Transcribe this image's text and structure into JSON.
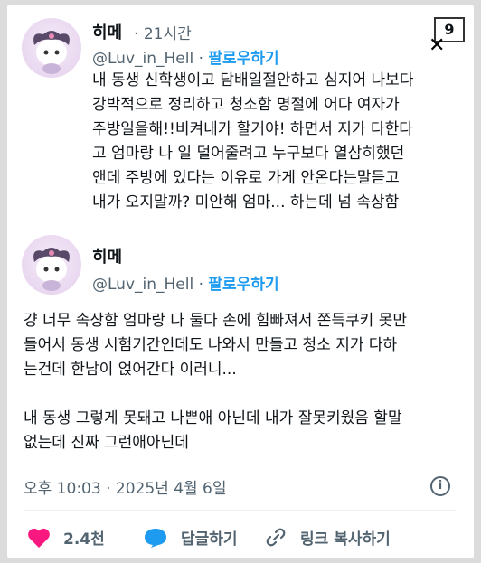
{
  "tweet1": {
    "name": "히메",
    "dot": "·",
    "time": "21시간",
    "handle": "@Luv_in_Hell",
    "follow": "팔로우하기",
    "text": "내 동생 신학생이고 담배일절안하고 심지어 나보다\n강박적으로 정리하고 청소함 명절에 어다 여자가\n주방일을해!!비켜내가 할거야! 하면서 지가 다한다\n고 엄마랑 나 일 덜어줄려고 누구보다 열삼히했던\n앤데 주방에 있다는 이유로 가게 안온다는말듣고\n내가 오지말까? 미안해 엄마... 하는데 넘 속상함"
  },
  "tweet2": {
    "name": "히메",
    "handle": "@Luv_in_Hell",
    "follow": "팔로우하기",
    "text": "걍 너무 속상함 엄마랑 나 둘다 손에 힘빠져서 쫀득쿠키 못만\n들어서 동생 시험기간인데도 나와서 만들고 청소 지가 다하\n는건데 한남이 얹어간다 이러니...\n\n내 동생 그렇게 못돼고 나쁜애 아닌데 내가 잘못키웠음 할말\n없는데 진짜 그런애아닌데",
    "timestamp": "오후 10:03 · 2025년 4월 6일"
  },
  "actions": {
    "likes": "2.4천",
    "reply": "답글하기",
    "copy_link": "링크 복사하기"
  },
  "badge": "9",
  "colors": {
    "accent": "#1d9bf0",
    "like": "#f91880",
    "muted": "#536471"
  },
  "icons": [
    "heart-icon",
    "reply-bubble-icon",
    "link-icon",
    "info-icon",
    "x-logo-icon"
  ]
}
